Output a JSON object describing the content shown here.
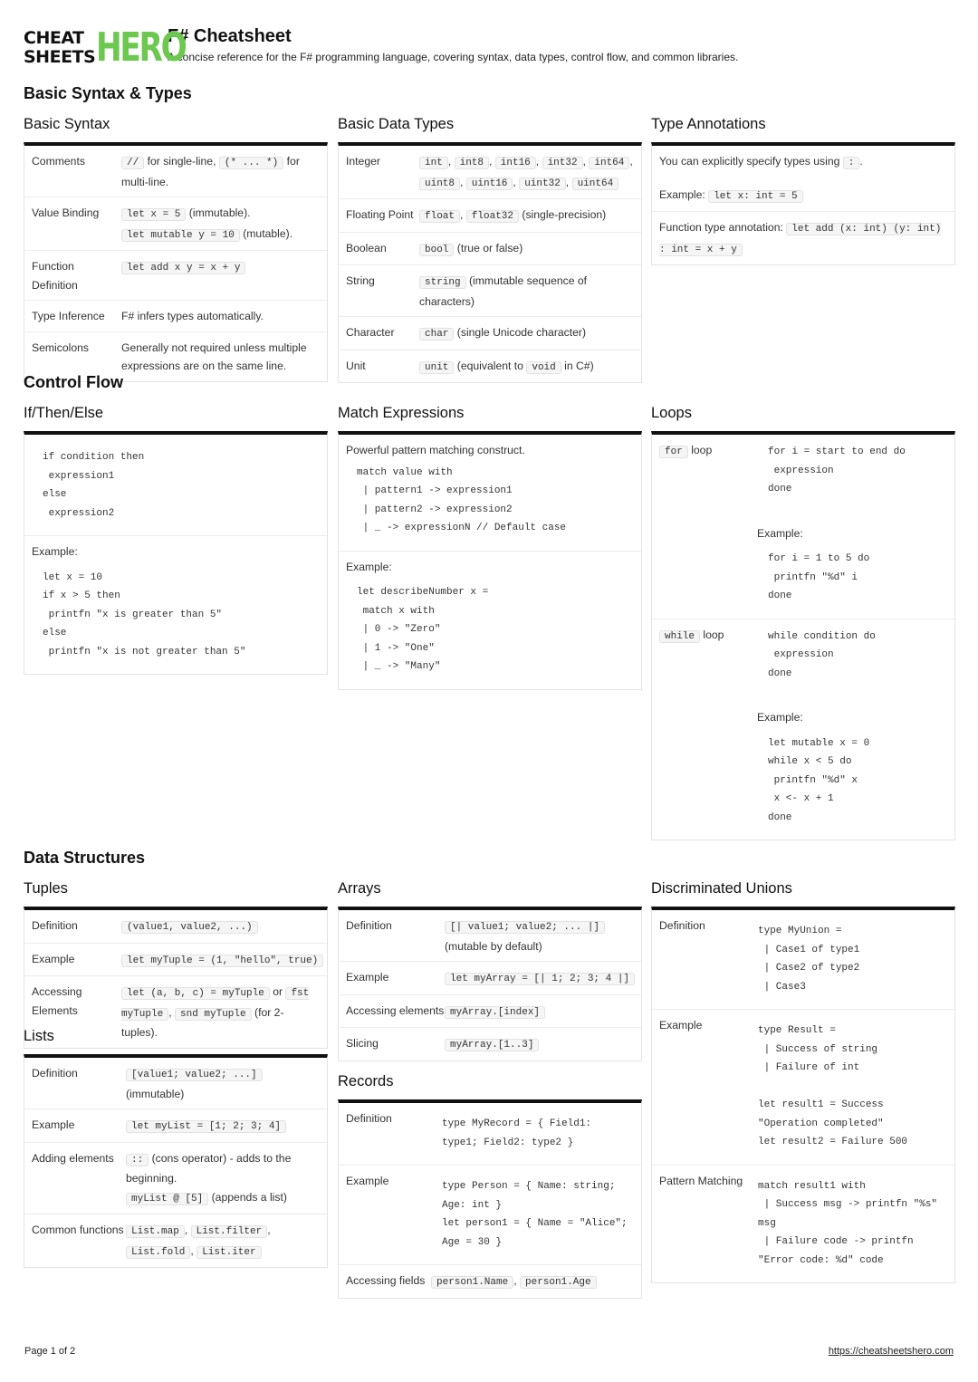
{
  "header": {
    "logo_top": "CHEAT",
    "logo_bottom": "SHEETS",
    "logo_accent": "HERO",
    "title": "F# Cheatsheet",
    "subtitle": "A concise reference for the F# programming language, covering syntax, data types, control flow, and common libraries."
  },
  "sections": {
    "basic": "Basic Syntax & Types",
    "control": "Control Flow",
    "data": "Data Structures"
  },
  "basic_syntax": {
    "title": "Basic Syntax",
    "comments": {
      "label": "Comments",
      "c1": "//",
      "t1": " for single-line, ",
      "c2": "(* ... *)",
      "t2": " for multi-line."
    },
    "binding": {
      "label": "Value Binding",
      "c1": "let x = 5",
      "t1": " (immutable).",
      "c2": "let mutable y = 10",
      "t2": " (mutable)."
    },
    "function": {
      "label": "Function Definition",
      "c1": "let add x y = x + y"
    },
    "inference": {
      "label": "Type Inference",
      "text": "F# infers types automatically."
    },
    "semicolons": {
      "label": "Semicolons",
      "text": "Generally not required unless multiple expressions are on the same line."
    }
  },
  "data_types": {
    "title": "Basic Data Types",
    "integer": {
      "label": "Integer",
      "codes": [
        "int",
        "int8",
        "int16",
        "int32",
        "int64",
        "uint8",
        "uint16",
        "uint32",
        "uint64"
      ]
    },
    "floating": {
      "label": "Floating Point",
      "c1": "float",
      "c2": "float32",
      "t": " (single-precision)"
    },
    "boolean": {
      "label": "Boolean",
      "c": "bool",
      "t": " (true or false)"
    },
    "string": {
      "label": "String",
      "c": "string",
      "t": " (immutable sequence of characters)"
    },
    "character": {
      "label": "Character",
      "c": "char",
      "t": " (single Unicode character)"
    },
    "unit": {
      "label": "Unit",
      "c1": "unit",
      "t1": " (equivalent to ",
      "c2": "void",
      "t2": " in C#)"
    }
  },
  "type_annotations": {
    "title": "Type Annotations",
    "t1": "You can explicitly specify types using ",
    "c1": ":",
    "t1b": ".",
    "example_label": "Example: ",
    "c2": "let x: int = 5",
    "t3": "Function type annotation: ",
    "c3": "let add (x: int) (y: int) : int = x + y"
  },
  "if_then_else": {
    "title": "If/Then/Else",
    "syntax": "if condition then\n expression1\nelse\n expression2",
    "example_label": "Example:",
    "example": "let x = 10\nif x > 5 then\n printfn \"x is greater than 5\"\nelse\n printfn \"x is not greater than 5\""
  },
  "match": {
    "title": "Match Expressions",
    "desc": "Powerful pattern matching construct.",
    "syntax": "match value with\n | pattern1 -> expression1\n | pattern2 -> expression2\n | _ -> expressionN // Default case",
    "example_label": "Example:",
    "example": "let describeNumber x =\n match x with\n | 0 -> \"Zero\"\n | 1 -> \"One\"\n | _ -> \"Many\""
  },
  "loops": {
    "title": "Loops",
    "for_code": "for",
    "for_label": " loop",
    "for_syntax": "for i = start to end do\n expression\ndone",
    "for_example_label": "Example:",
    "for_example": "for i = 1 to 5 do\n printfn \"%d\" i\ndone",
    "while_code": "while",
    "while_label": " loop",
    "while_syntax": "while condition do\n expression\ndone",
    "while_example_label": "Example:",
    "while_example": "let mutable x = 0\nwhile x < 5 do\n printfn \"%d\" x\n x <- x + 1\ndone"
  },
  "tuples": {
    "title": "Tuples",
    "definition": {
      "label": "Definition",
      "c": "(value1, value2, ...)"
    },
    "example": {
      "label": "Example",
      "c": "let myTuple = (1, \"hello\", true)"
    },
    "accessing": {
      "label": "Accessing Elements",
      "c1": "let (a, b, c) = myTuple",
      "t1": " or ",
      "c2": "fst myTuple",
      "t2": ", ",
      "c3": "snd myTuple",
      "t3": " (for 2-tuples)."
    }
  },
  "lists": {
    "title": "Lists",
    "definition": {
      "label": "Definition",
      "c": "[value1; value2; ...]",
      "t": " (immutable)"
    },
    "example": {
      "label": "Example",
      "c": "let myList = [1; 2; 3; 4]"
    },
    "adding": {
      "label": "Adding elements",
      "c1": "::",
      "t1": " (cons operator) - adds to the beginning.",
      "c2": "myList @ [5]",
      "t2": " (appends a list)"
    },
    "common": {
      "label": "Common functions",
      "codes": [
        "List.map",
        "List.filter",
        "List.fold",
        "List.iter"
      ]
    }
  },
  "arrays": {
    "title": "Arrays",
    "definition": {
      "label": "Definition",
      "c": "[| value1; value2; ... |]",
      "t": "(mutable by default)"
    },
    "example": {
      "label": "Example",
      "c": "let myArray = [| 1; 2; 3; 4 |]"
    },
    "accessing": {
      "label": "Accessing elements",
      "c": "myArray.[index]"
    },
    "slicing": {
      "label": "Slicing",
      "c": "myArray.[1..3]"
    }
  },
  "records": {
    "title": "Records",
    "definition": {
      "label": "Definition",
      "code": "type MyRecord = { Field1:\ntype1; Field2: type2 }"
    },
    "example": {
      "label": "Example",
      "code": "type Person = { Name: string;\nAge: int }\nlet person1 = { Name = \"Alice\";\nAge = 30 }"
    },
    "accessing": {
      "label": "Accessing fields",
      "c1": "person1.Name",
      "t": ", ",
      "c2": "person1.Age"
    }
  },
  "unions": {
    "title": "Discriminated Unions",
    "definition": {
      "label": "Definition",
      "code": "type MyUnion =\n | Case1 of type1\n | Case2 of type2\n | Case3"
    },
    "example": {
      "label": "Example",
      "code": "type Result =\n | Success of string\n | Failure of int\n\nlet result1 = Success\n\"Operation completed\"\nlet result2 = Failure 500"
    },
    "pattern": {
      "label": "Pattern Matching",
      "code": "match result1 with\n | Success msg -> printfn \"%s\"\nmsg\n | Failure code -> printfn\n\"Error code: %d\" code"
    }
  },
  "footer": {
    "page": "Page 1 of 2",
    "url": "https://cheatsheetshero.com"
  }
}
